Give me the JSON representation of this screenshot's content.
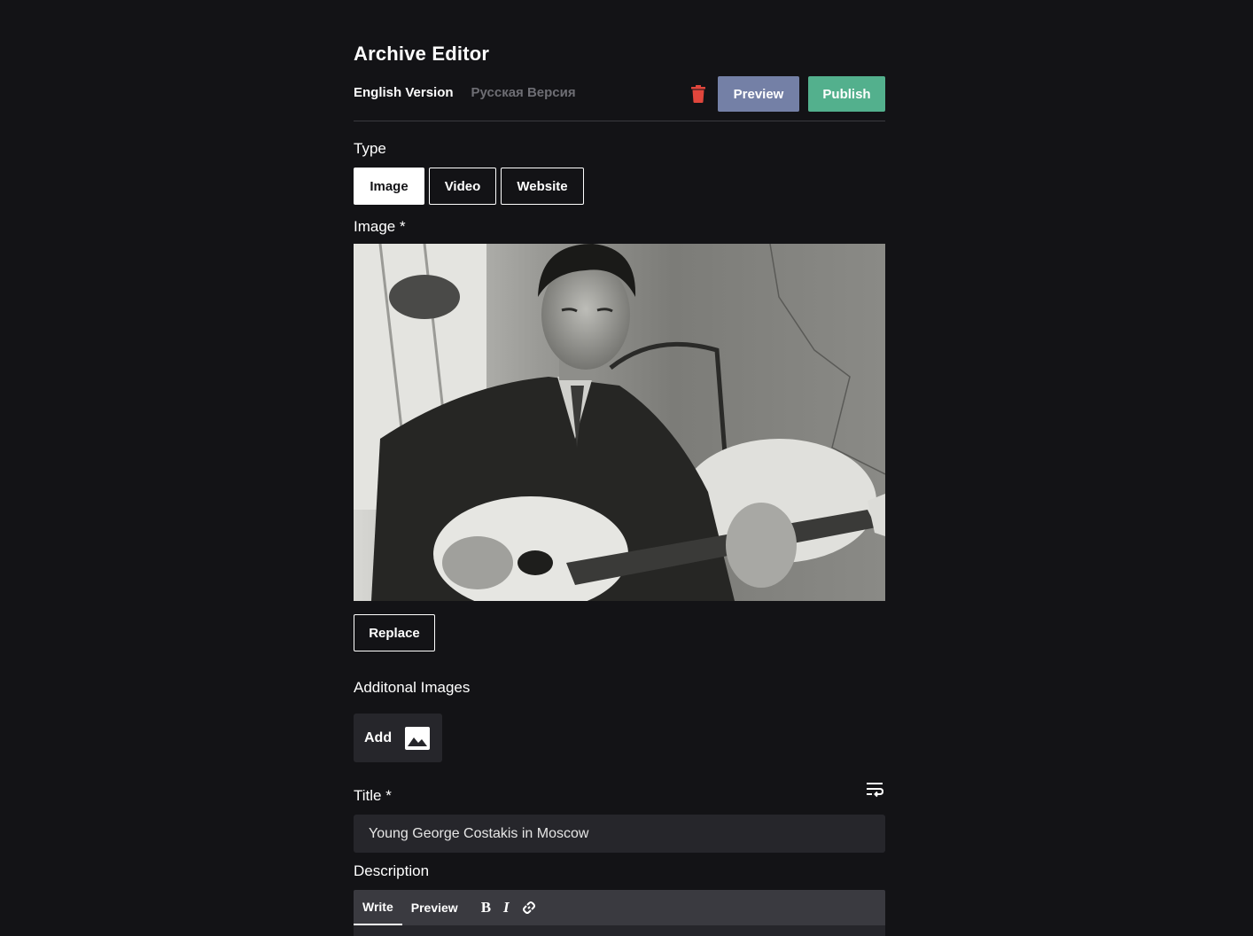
{
  "page": {
    "title": "Archive Editor"
  },
  "language_tabs": [
    {
      "label": "English Version",
      "active": true
    },
    {
      "label": "Русская Версия",
      "active": false
    }
  ],
  "actions": {
    "delete_icon": "trash-icon",
    "preview_label": "Preview",
    "publish_label": "Publish",
    "preview_color": "#7480a6",
    "publish_color": "#53b08d",
    "delete_color": "#e0463c"
  },
  "type_field": {
    "label": "Type",
    "options": [
      "Image",
      "Video",
      "Website"
    ],
    "selected": "Image"
  },
  "image_field": {
    "label": "Image *",
    "replace_label": "Replace"
  },
  "additional_images": {
    "label": "Additonal Images",
    "add_label": "Add",
    "icon": "image-icon"
  },
  "title_field": {
    "label": "Title *",
    "value": "Young George Costakis in Moscow",
    "wrap_icon": "text-wrap-icon"
  },
  "description_field": {
    "label": "Description",
    "tabs": [
      {
        "label": "Write",
        "active": true
      },
      {
        "label": "Preview",
        "active": false
      }
    ],
    "tools": {
      "bold": "B",
      "italic": "I",
      "link_icon": "link-icon"
    }
  }
}
